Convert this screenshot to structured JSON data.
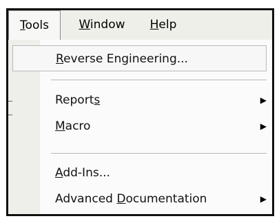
{
  "menubar": {
    "tools": {
      "prefix": "",
      "mnemonic": "T",
      "rest": "ools"
    },
    "window": {
      "prefix": "",
      "mnemonic": "W",
      "rest": "indow"
    },
    "help": {
      "prefix": "",
      "mnemonic": "H",
      "rest": "elp"
    }
  },
  "menu": {
    "items": [
      {
        "prefix": "",
        "mnemonic": "R",
        "rest": "everse Engineering...",
        "submenu": false
      },
      {
        "prefix": "Report",
        "mnemonic": "s",
        "rest": "",
        "submenu": true
      },
      {
        "prefix": "",
        "mnemonic": "M",
        "rest": "acro",
        "submenu": true
      },
      {
        "prefix": "",
        "mnemonic": "A",
        "rest": "dd-Ins...",
        "submenu": false
      },
      {
        "prefix": "Advanced ",
        "mnemonic": "D",
        "rest": "ocumentation",
        "submenu": true
      }
    ]
  },
  "icons": {
    "submenu_arrow": "▶"
  }
}
